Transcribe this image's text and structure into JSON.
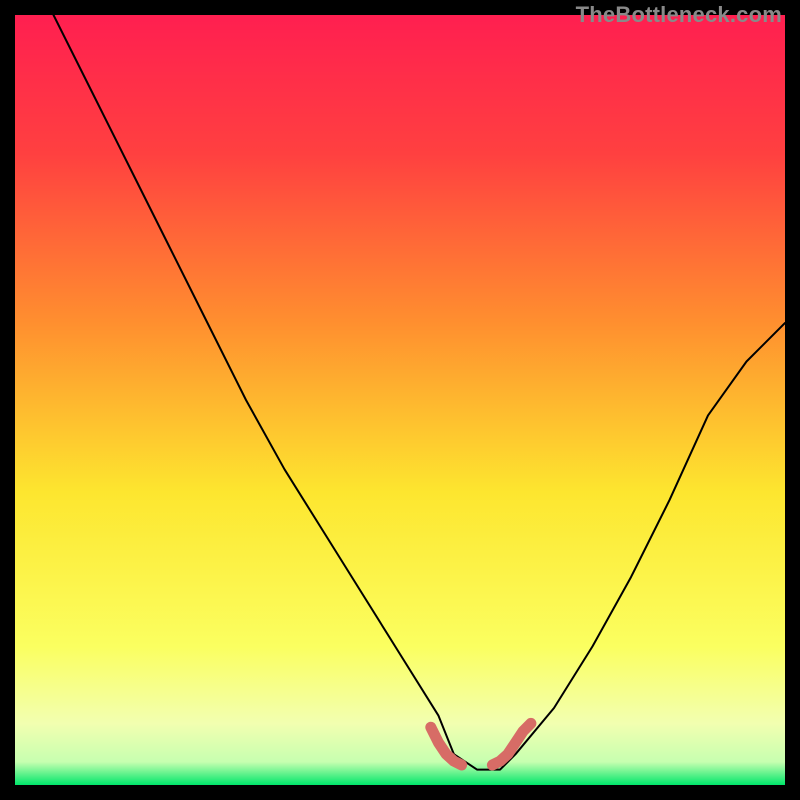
{
  "watermark": "TheBottleneck.com",
  "colors": {
    "bg": "#000000",
    "grad_top": "#ff1f50",
    "grad_mid1": "#ff8f2f",
    "grad_mid2": "#fde62f",
    "grad_low": "#f9ff9a",
    "grad_bottom": "#00e66a",
    "curve": "#000000",
    "marker": "#d76c66"
  },
  "chart_data": {
    "type": "line",
    "title": "",
    "xlabel": "",
    "ylabel": "",
    "xlim": [
      0,
      100
    ],
    "ylim": [
      0,
      100
    ],
    "series": [
      {
        "name": "bottleneck-curve",
        "x": [
          5,
          10,
          15,
          20,
          25,
          30,
          35,
          40,
          45,
          50,
          55,
          57,
          60,
          63,
          65,
          70,
          75,
          80,
          85,
          90,
          95,
          100
        ],
        "y": [
          100,
          90,
          80,
          70,
          60,
          50,
          41,
          33,
          25,
          17,
          9,
          4,
          2,
          2,
          4,
          10,
          18,
          27,
          37,
          48,
          55,
          60
        ]
      }
    ],
    "markers": [
      {
        "name": "left-bump",
        "x": [
          54,
          55,
          56,
          57,
          58
        ],
        "y": [
          7.5,
          5.5,
          4.0,
          3.1,
          2.6
        ]
      },
      {
        "name": "right-bump",
        "x": [
          62,
          63,
          64,
          65,
          66,
          67
        ],
        "y": [
          2.6,
          3.1,
          4.0,
          5.5,
          7.0,
          8.0
        ]
      }
    ],
    "annotations": []
  }
}
